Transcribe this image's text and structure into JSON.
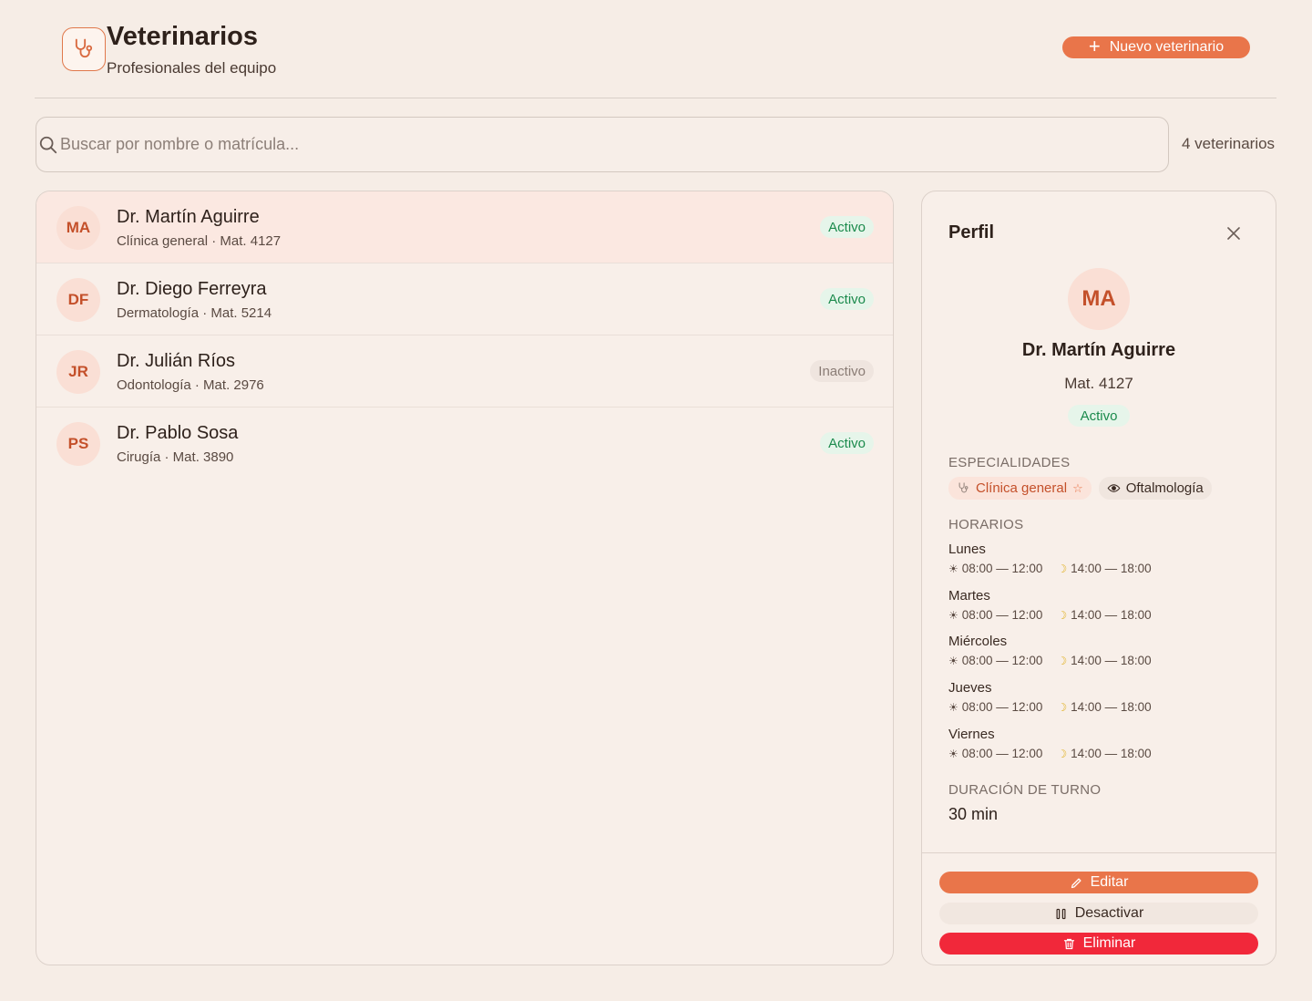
{
  "header": {
    "title": "Veterinarios",
    "subtitle": "Profesionales del equipo",
    "new_button": "Nuevo veterinario",
    "logo_icon": "stethoscope-icon"
  },
  "search": {
    "placeholder": "Buscar por nombre o matrícula...",
    "value": "",
    "count_label": "4 veterinarios"
  },
  "vets": [
    {
      "initials": "MA",
      "name": "Dr. Martín Aguirre",
      "meta": "Clínica general · Mat. 4127",
      "status": "Activo"
    },
    {
      "initials": "DF",
      "name": "Dr. Diego Ferreyra",
      "meta": "Dermatología · Mat. 5214",
      "status": "Activo"
    },
    {
      "initials": "JR",
      "name": "Dr. Julián Ríos",
      "meta": "Odontología · Mat. 2976",
      "status": "Inactivo"
    },
    {
      "initials": "PS",
      "name": "Dr. Pablo Sosa",
      "meta": "Cirugía · Mat. 3890",
      "status": "Activo"
    }
  ],
  "profile": {
    "title": "Perfil",
    "initials": "MA",
    "name": "Dr. Martín Aguirre",
    "mat": "Mat. 4127",
    "status": "Activo",
    "specialties_label": "ESPECIALIDADES",
    "specialties": [
      {
        "label": "Clínica general",
        "icon": "stethoscope-icon",
        "primary": true,
        "mark": "☆"
      },
      {
        "label": "Oftalmología",
        "icon": "eye-icon",
        "primary": false
      }
    ],
    "schedule_label": "HORARIOS",
    "schedule": [
      {
        "day": "Lunes",
        "morning": "08:00 — 12:00",
        "afternoon": "14:00 — 18:00"
      },
      {
        "day": "Martes",
        "morning": "08:00 — 12:00",
        "afternoon": "14:00 — 18:00"
      },
      {
        "day": "Miércoles",
        "morning": "08:00 — 12:00",
        "afternoon": "14:00 — 18:00"
      },
      {
        "day": "Jueves",
        "morning": "08:00 — 12:00",
        "afternoon": "14:00 — 18:00"
      },
      {
        "day": "Viernes",
        "morning": "08:00 — 12:00",
        "afternoon": "14:00 — 18:00"
      }
    ],
    "duration_label": "DURACIÓN DE TURNO",
    "duration": "30 min",
    "actions": {
      "edit": "Editar",
      "deactivate": "Desactivar",
      "delete": "Eliminar"
    }
  },
  "colors": {
    "accent": "#e9754a",
    "danger": "#f1283a",
    "active": "#1b8a4c",
    "background": "#f6ede6"
  }
}
